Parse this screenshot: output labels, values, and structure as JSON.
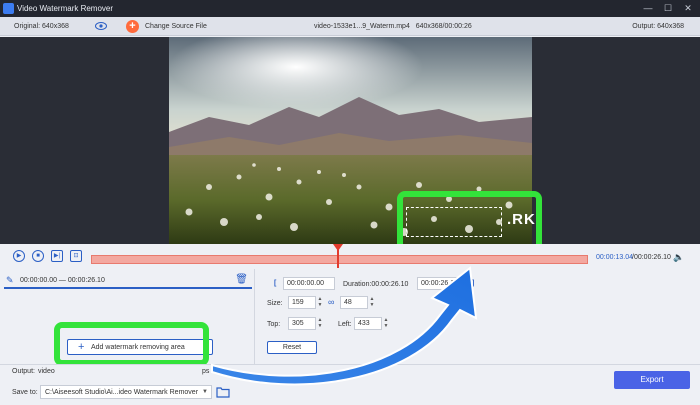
{
  "window": {
    "title": "Video Watermark Remover",
    "icon": "app-icon"
  },
  "window_controls": {
    "minimize": "—",
    "maximize": "☐",
    "close": "✕"
  },
  "infobar": {
    "original": "Original: 640x368",
    "change_source": "Change Source File",
    "filename": "video-1533e1...9_Waterm.mp4",
    "file_info": "640x368/00:00:26",
    "output": "Output: 640x368"
  },
  "preview": {
    "watermark_text": ".RK"
  },
  "controls": {
    "current_time": "00:00:13.04",
    "total_time": "/00:00:26.10",
    "progress": 0.5
  },
  "segment": {
    "range": "00:00:00.00 — 00:00:26.10"
  },
  "add_area": {
    "label": "Add watermark removing area"
  },
  "area": {
    "start": "00:00:00.00",
    "duration": "Duration:00:00:26.10",
    "end": "00:00:26.10",
    "size_label": "Size:",
    "width": "159",
    "height": "48",
    "top_label": "Top:",
    "top": "305",
    "left_label": "Left:",
    "left": "433",
    "reset": "Reset",
    "bracket_left": "[",
    "bracket_right": "]"
  },
  "bottom": {
    "output_label": "Output:",
    "output_value": "video",
    "steps_fragment": "ps",
    "save_label": "Save to:",
    "save_path": "C:\\Aiseesoft Studio\\Ai...ideo Watermark Remover",
    "export": "Export"
  },
  "colors": {
    "accent": "#2b5fc5",
    "highlight": "#33e33a",
    "export": "#4a63e6",
    "timeline": "#f3a8a0"
  }
}
